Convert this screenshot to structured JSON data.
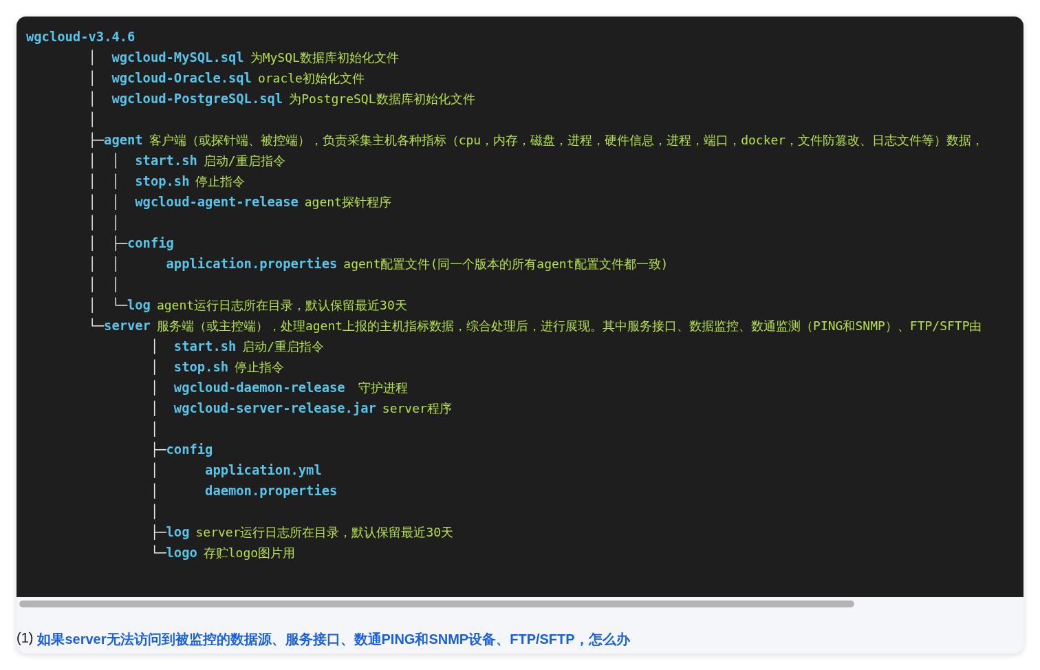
{
  "code_lines": [
    {
      "name": "wgcloud-v3.4.6"
    },
    {
      "tree": "        │  ",
      "name": "wgcloud-MySQL.sql",
      "desc": "为MySQL数据库初始化文件"
    },
    {
      "tree": "        │  ",
      "name": "wgcloud-Oracle.sql",
      "desc": "oracle初始化文件"
    },
    {
      "tree": "        │  ",
      "name": "wgcloud-PostgreSQL.sql",
      "desc": "为PostgreSQL数据库初始化文件"
    },
    {
      "tree": "        │"
    },
    {
      "tree": "        ├─",
      "name": "agent",
      "desc": "客户端（或探针端、被控端），负责采集主机各种指标（cpu，内存，磁盘，进程，硬件信息，进程，端口，docker，文件防篡改、日志文件等）数据，"
    },
    {
      "tree": "        │  │  ",
      "name": "start.sh",
      "desc": "启动/重启指令"
    },
    {
      "tree": "        │  │  ",
      "name": "stop.sh",
      "desc": "停止指令"
    },
    {
      "tree": "        │  │  ",
      "name": "wgcloud-agent-release",
      "desc": "agent探针程序"
    },
    {
      "tree": "        │  │"
    },
    {
      "tree": "        │  ├─",
      "name": "config"
    },
    {
      "tree": "        │  │      ",
      "name": "application.properties",
      "desc": "agent配置文件(同一个版本的所有agent配置文件都一致)"
    },
    {
      "tree": "        │  │"
    },
    {
      "tree": "        │  └─",
      "name": "log",
      "desc": "agent运行日志所在目录，默认保留最近30天"
    },
    {
      "tree": "        └─",
      "name": "server",
      "desc": "服务端（或主控端），处理agent上报的主机指标数据，综合处理后，进行展现。其中服务接口、数据监控、数通监测（PING和SNMP）、FTP/SFTP由"
    },
    {
      "tree": "                │  ",
      "name": "start.sh",
      "desc": "启动/重启指令"
    },
    {
      "tree": "                │  ",
      "name": "stop.sh",
      "desc": "停止指令"
    },
    {
      "tree": "                │  ",
      "name": "wgcloud-daemon-release",
      "desc": " 守护进程"
    },
    {
      "tree": "                │  ",
      "name": "wgcloud-server-release.jar",
      "desc": "server程序"
    },
    {
      "tree": "                │"
    },
    {
      "tree": "                ├─",
      "name": "config"
    },
    {
      "tree": "                │      ",
      "name": "application.yml"
    },
    {
      "tree": "                │      ",
      "name": "daemon.properties"
    },
    {
      "tree": "                │"
    },
    {
      "tree": "                ├─",
      "name": "log",
      "desc": "server运行日志所在目录，默认保留最近30天"
    },
    {
      "tree": "                └─",
      "name": "logo",
      "desc": "存贮logo图片用"
    }
  ],
  "footer": {
    "number": "(1)",
    "link": "如果server无法访问到被监控的数据源、服务接口、数通PING和SNMP设备、FTP/SFTP，怎么办"
  }
}
